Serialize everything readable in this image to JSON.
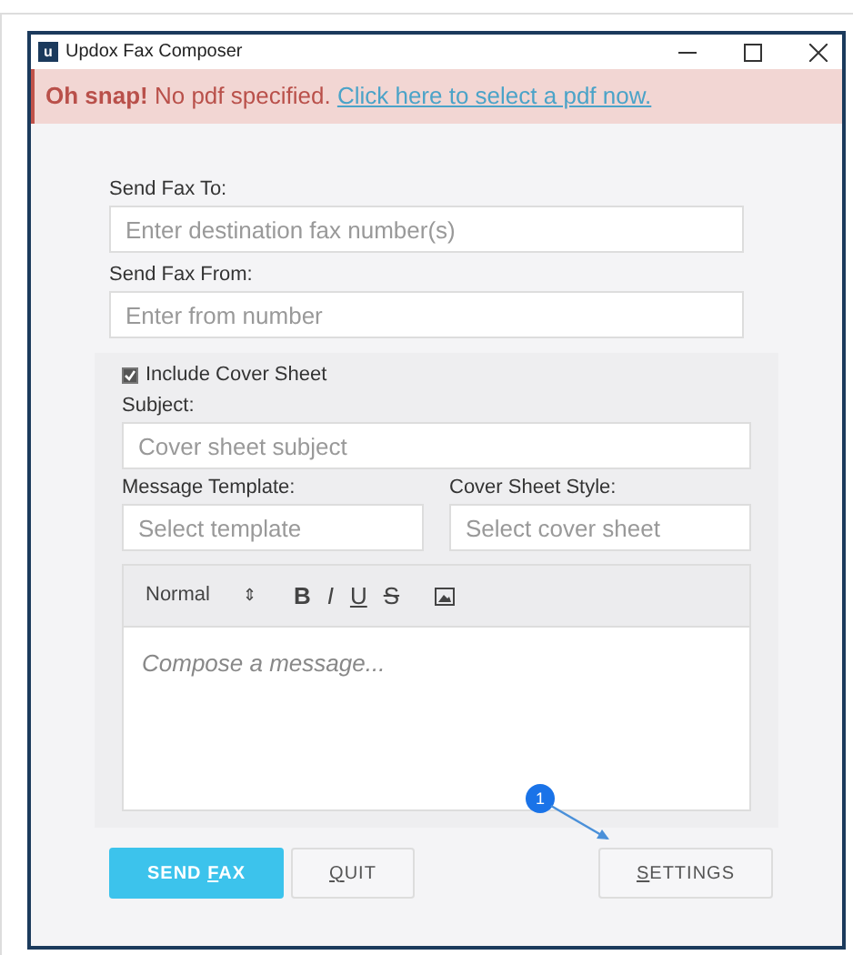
{
  "window": {
    "title": "Updox Fax Composer",
    "logo": "u"
  },
  "alert": {
    "strong": "Oh snap!",
    "message": "No pdf specified.",
    "link": "Click here to select a pdf now."
  },
  "fields": [
    {
      "label": "Send Fax To:",
      "placeholder": "Enter destination fax number(s)"
    },
    {
      "label": "Send Fax From:",
      "placeholder": "Enter from number"
    }
  ],
  "cover": {
    "include": {
      "label": "Include Cover Sheet",
      "checked": true
    },
    "subject": {
      "label": "Subject:",
      "placeholder": "Cover sheet subject"
    },
    "template": {
      "label": "Message Template:",
      "placeholder": "Select template"
    },
    "style": {
      "label": "Cover Sheet Style:",
      "placeholder": "Select cover sheet"
    }
  },
  "editor": {
    "format": "Normal",
    "format_arrows": "⇕",
    "tools": [
      {
        "kind": "bold",
        "label": "B"
      },
      {
        "kind": "italic",
        "label": "I"
      },
      {
        "kind": "underline",
        "label": "U"
      },
      {
        "kind": "strike",
        "label": "S"
      },
      {
        "kind": "image"
      }
    ],
    "placeholder": "Compose a message..."
  },
  "buttons": [
    {
      "kind": "primary",
      "before": "SEND ",
      "key": "F",
      "after": "AX"
    },
    {
      "kind": "plain",
      "key": "Q",
      "after": "UIT"
    },
    {
      "kind": "plain",
      "key": "S",
      "after": "ETTINGS"
    }
  ],
  "annotation": {
    "label": "1"
  }
}
